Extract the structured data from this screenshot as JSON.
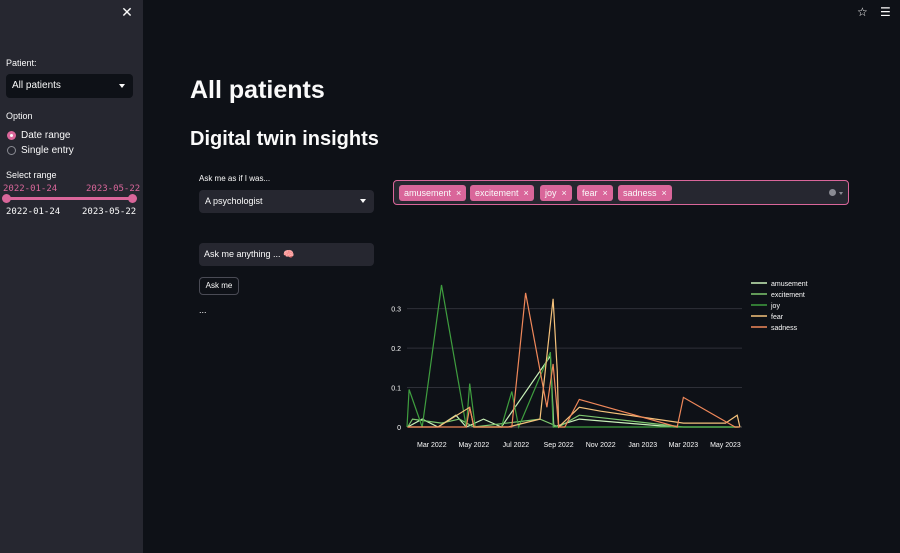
{
  "sidebar": {
    "close_icon": "close-icon",
    "patient_label": "Patient:",
    "patient_value": "All patients",
    "option_label": "Option",
    "options": [
      "Date range",
      "Single entry"
    ],
    "selected_option": "Date range",
    "range_label": "Select range",
    "range_low": "2022-01-24",
    "range_high": "2023-05-22",
    "range_min": "2022-01-24",
    "range_max": "2023-05-22"
  },
  "topbar": {
    "icons": [
      "star-icon",
      "hamburger-menu-icon"
    ]
  },
  "main": {
    "title": "All patients",
    "subtitle": "Digital twin insights",
    "persona_label": "Ask me as if I was...",
    "persona_value": "A psychologist",
    "ask_placeholder": "Ask me anything ... 🧠",
    "ask_button": "Ask me",
    "answer": "..."
  },
  "emotion_filter": {
    "selected": [
      "amusement",
      "excitement",
      "joy",
      "fear",
      "sadness"
    ],
    "remove_icon": "×"
  },
  "colors": {
    "accent": "#d9669a",
    "background": "#0e1117",
    "sidebar": "#262730"
  },
  "chart_data": {
    "type": "line",
    "xlabel": "",
    "ylabel": "",
    "x_ticks": [
      "Mar 2022",
      "May 2022",
      "Jul 2022",
      "Sep 2022",
      "Nov 2022",
      "Jan 2023",
      "Mar 2023",
      "May 2023"
    ],
    "y_ticks": [
      "0",
      "0.1",
      "0.2",
      "0.3"
    ],
    "ylim": [
      0,
      0.36
    ],
    "legend_position": "top-right",
    "series": [
      {
        "name": "amusement",
        "color": "#c8f0b8",
        "points": [
          [
            "2022-01-25",
            0
          ],
          [
            "2022-02-15",
            0.02
          ],
          [
            "2022-03-10",
            0
          ],
          [
            "2022-04-05",
            0.03
          ],
          [
            "2022-04-20",
            0
          ],
          [
            "2022-05-15",
            0.02
          ],
          [
            "2022-06-10",
            0
          ],
          [
            "2022-08-20",
            0.18
          ],
          [
            "2022-08-25",
            0
          ],
          [
            "2022-10-01",
            0.02
          ],
          [
            "2023-02-15",
            0
          ],
          [
            "2023-05-20",
            0
          ]
        ]
      },
      {
        "name": "excitement",
        "color": "#7ec86f",
        "points": [
          [
            "2022-01-25",
            0
          ],
          [
            "2022-02-01",
            0.02
          ],
          [
            "2022-03-15",
            0.01
          ],
          [
            "2022-04-10",
            0.02
          ],
          [
            "2022-05-01",
            0
          ],
          [
            "2022-08-05",
            0.02
          ],
          [
            "2022-09-01",
            0
          ],
          [
            "2022-10-01",
            0.03
          ],
          [
            "2023-03-01",
            0
          ],
          [
            "2023-05-20",
            0
          ]
        ]
      },
      {
        "name": "joy",
        "color": "#3f9e3f",
        "points": [
          [
            "2022-01-24",
            0
          ],
          [
            "2022-01-27",
            0.095
          ],
          [
            "2022-02-15",
            0
          ],
          [
            "2022-03-15",
            0.36
          ],
          [
            "2022-04-20",
            0
          ],
          [
            "2022-04-25",
            0.11
          ],
          [
            "2022-05-03",
            0
          ],
          [
            "2022-06-10",
            0
          ],
          [
            "2022-06-25",
            0.09
          ],
          [
            "2022-07-05",
            0
          ],
          [
            "2022-08-20",
            0.19
          ],
          [
            "2022-08-24",
            0
          ],
          [
            "2022-10-01",
            0
          ],
          [
            "2023-05-20",
            0
          ]
        ]
      },
      {
        "name": "fear",
        "color": "#f5c27b",
        "points": [
          [
            "2022-01-25",
            0
          ],
          [
            "2022-03-10",
            0
          ],
          [
            "2022-04-25",
            0.05
          ],
          [
            "2022-05-01",
            0
          ],
          [
            "2022-06-20",
            0
          ],
          [
            "2022-08-05",
            0.02
          ],
          [
            "2022-08-24",
            0.325
          ],
          [
            "2022-08-30",
            0.14
          ],
          [
            "2022-09-01",
            0
          ],
          [
            "2022-10-01",
            0.05
          ],
          [
            "2022-11-01",
            0.04
          ],
          [
            "2023-03-01",
            0.01
          ],
          [
            "2023-05-01",
            0.01
          ],
          [
            "2023-05-18",
            0.03
          ],
          [
            "2023-05-22",
            0
          ]
        ]
      },
      {
        "name": "sadness",
        "color": "#f0885a",
        "points": [
          [
            "2022-01-25",
            0
          ],
          [
            "2022-04-20",
            0
          ],
          [
            "2022-04-25",
            0.05
          ],
          [
            "2022-05-01",
            0
          ],
          [
            "2022-06-25",
            0
          ],
          [
            "2022-07-15",
            0.34
          ],
          [
            "2022-08-15",
            0.05
          ],
          [
            "2022-08-24",
            0.16
          ],
          [
            "2022-09-01",
            0
          ],
          [
            "2022-09-10",
            0
          ],
          [
            "2022-10-01",
            0.07
          ],
          [
            "2023-02-20",
            0
          ],
          [
            "2023-03-01",
            0.075
          ],
          [
            "2023-05-15",
            0
          ],
          [
            "2023-05-22",
            0
          ]
        ]
      }
    ]
  }
}
